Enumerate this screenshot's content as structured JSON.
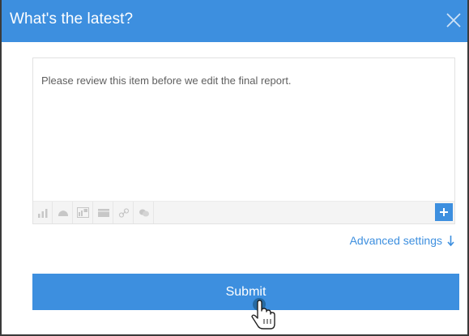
{
  "dialog": {
    "title": "What's the latest?",
    "close_icon": "close-icon"
  },
  "editor": {
    "value": "Please review this item before we edit the final report.",
    "toolbar_icons": [
      "bar-chart-icon",
      "cloud-icon",
      "dashboard-icon",
      "report-icon",
      "link-icon",
      "comment-icon"
    ],
    "add_icon": "plus-icon"
  },
  "advanced_settings": {
    "label": "Advanced settings",
    "icon": "arrow-down-icon"
  },
  "submit": {
    "label": "Submit"
  },
  "colors": {
    "accent": "#3d8fdf",
    "toolbar_bg": "#f4f4f4",
    "text": "#5f5f5f"
  }
}
